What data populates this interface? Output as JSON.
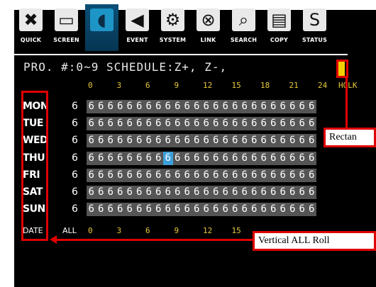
{
  "toolbar": {
    "items": [
      {
        "label": "QUICK",
        "icon": "tools-icon",
        "glyph": "✖"
      },
      {
        "label": "SCREEN",
        "icon": "monitor-icon",
        "glyph": "▭"
      },
      {
        "label": "",
        "icon": "camera-icon",
        "glyph": "◖"
      },
      {
        "label": "EVENT",
        "icon": "speaker-icon",
        "glyph": "◀"
      },
      {
        "label": "SYSTEM",
        "icon": "gears-icon",
        "glyph": "⚙"
      },
      {
        "label": "LINK",
        "icon": "satellite-icon",
        "glyph": "⊗"
      },
      {
        "label": "SEARCH",
        "icon": "magnifier-icon",
        "glyph": "⌕"
      },
      {
        "label": "COPY",
        "icon": "document-icon",
        "glyph": "▤"
      },
      {
        "label": "STATUS",
        "icon": "status-icon",
        "glyph": "S"
      }
    ]
  },
  "schedule": {
    "title": "PRO. #:0~9  SCHEDULE:Z+, Z-,",
    "hour_headers": [
      "0",
      "3",
      "6",
      "9",
      "12",
      "15",
      "18",
      "21",
      "24"
    ],
    "hour_suffix": "HOLK",
    "days": [
      {
        "name": "MON",
        "channel": "6",
        "cells": "666666666666666666666666"
      },
      {
        "name": "TUE",
        "channel": "6",
        "cells": "666666666666666666666666"
      },
      {
        "name": "WED",
        "channel": "6",
        "cells": "666666666666666666666666"
      },
      {
        "name": "THU",
        "channel": "6",
        "cells": "666666666666666666666666"
      },
      {
        "name": "FRI",
        "channel": "6",
        "cells": "666666666666666666666666"
      },
      {
        "name": "SAT",
        "channel": "6",
        "cells": "666666666666666666666666"
      },
      {
        "name": "SUN",
        "channel": "6",
        "cells": "666666666666666666666666"
      }
    ],
    "cursor": {
      "day": 3,
      "hour": 8
    },
    "date_row": {
      "label": "DATE",
      "all_label": "ALL",
      "hours": [
        "0",
        "3",
        "6",
        "9",
        "12",
        "15"
      ]
    }
  },
  "annotations": {
    "rectangle_callout": "Rectan",
    "vertical_callout": "Vertical ALL Roll",
    "color": "#e00000"
  },
  "colors": {
    "accent": "#1e95c7",
    "cursor": "#3ea0da",
    "marker": "#f1d200",
    "grid": "#555555"
  }
}
